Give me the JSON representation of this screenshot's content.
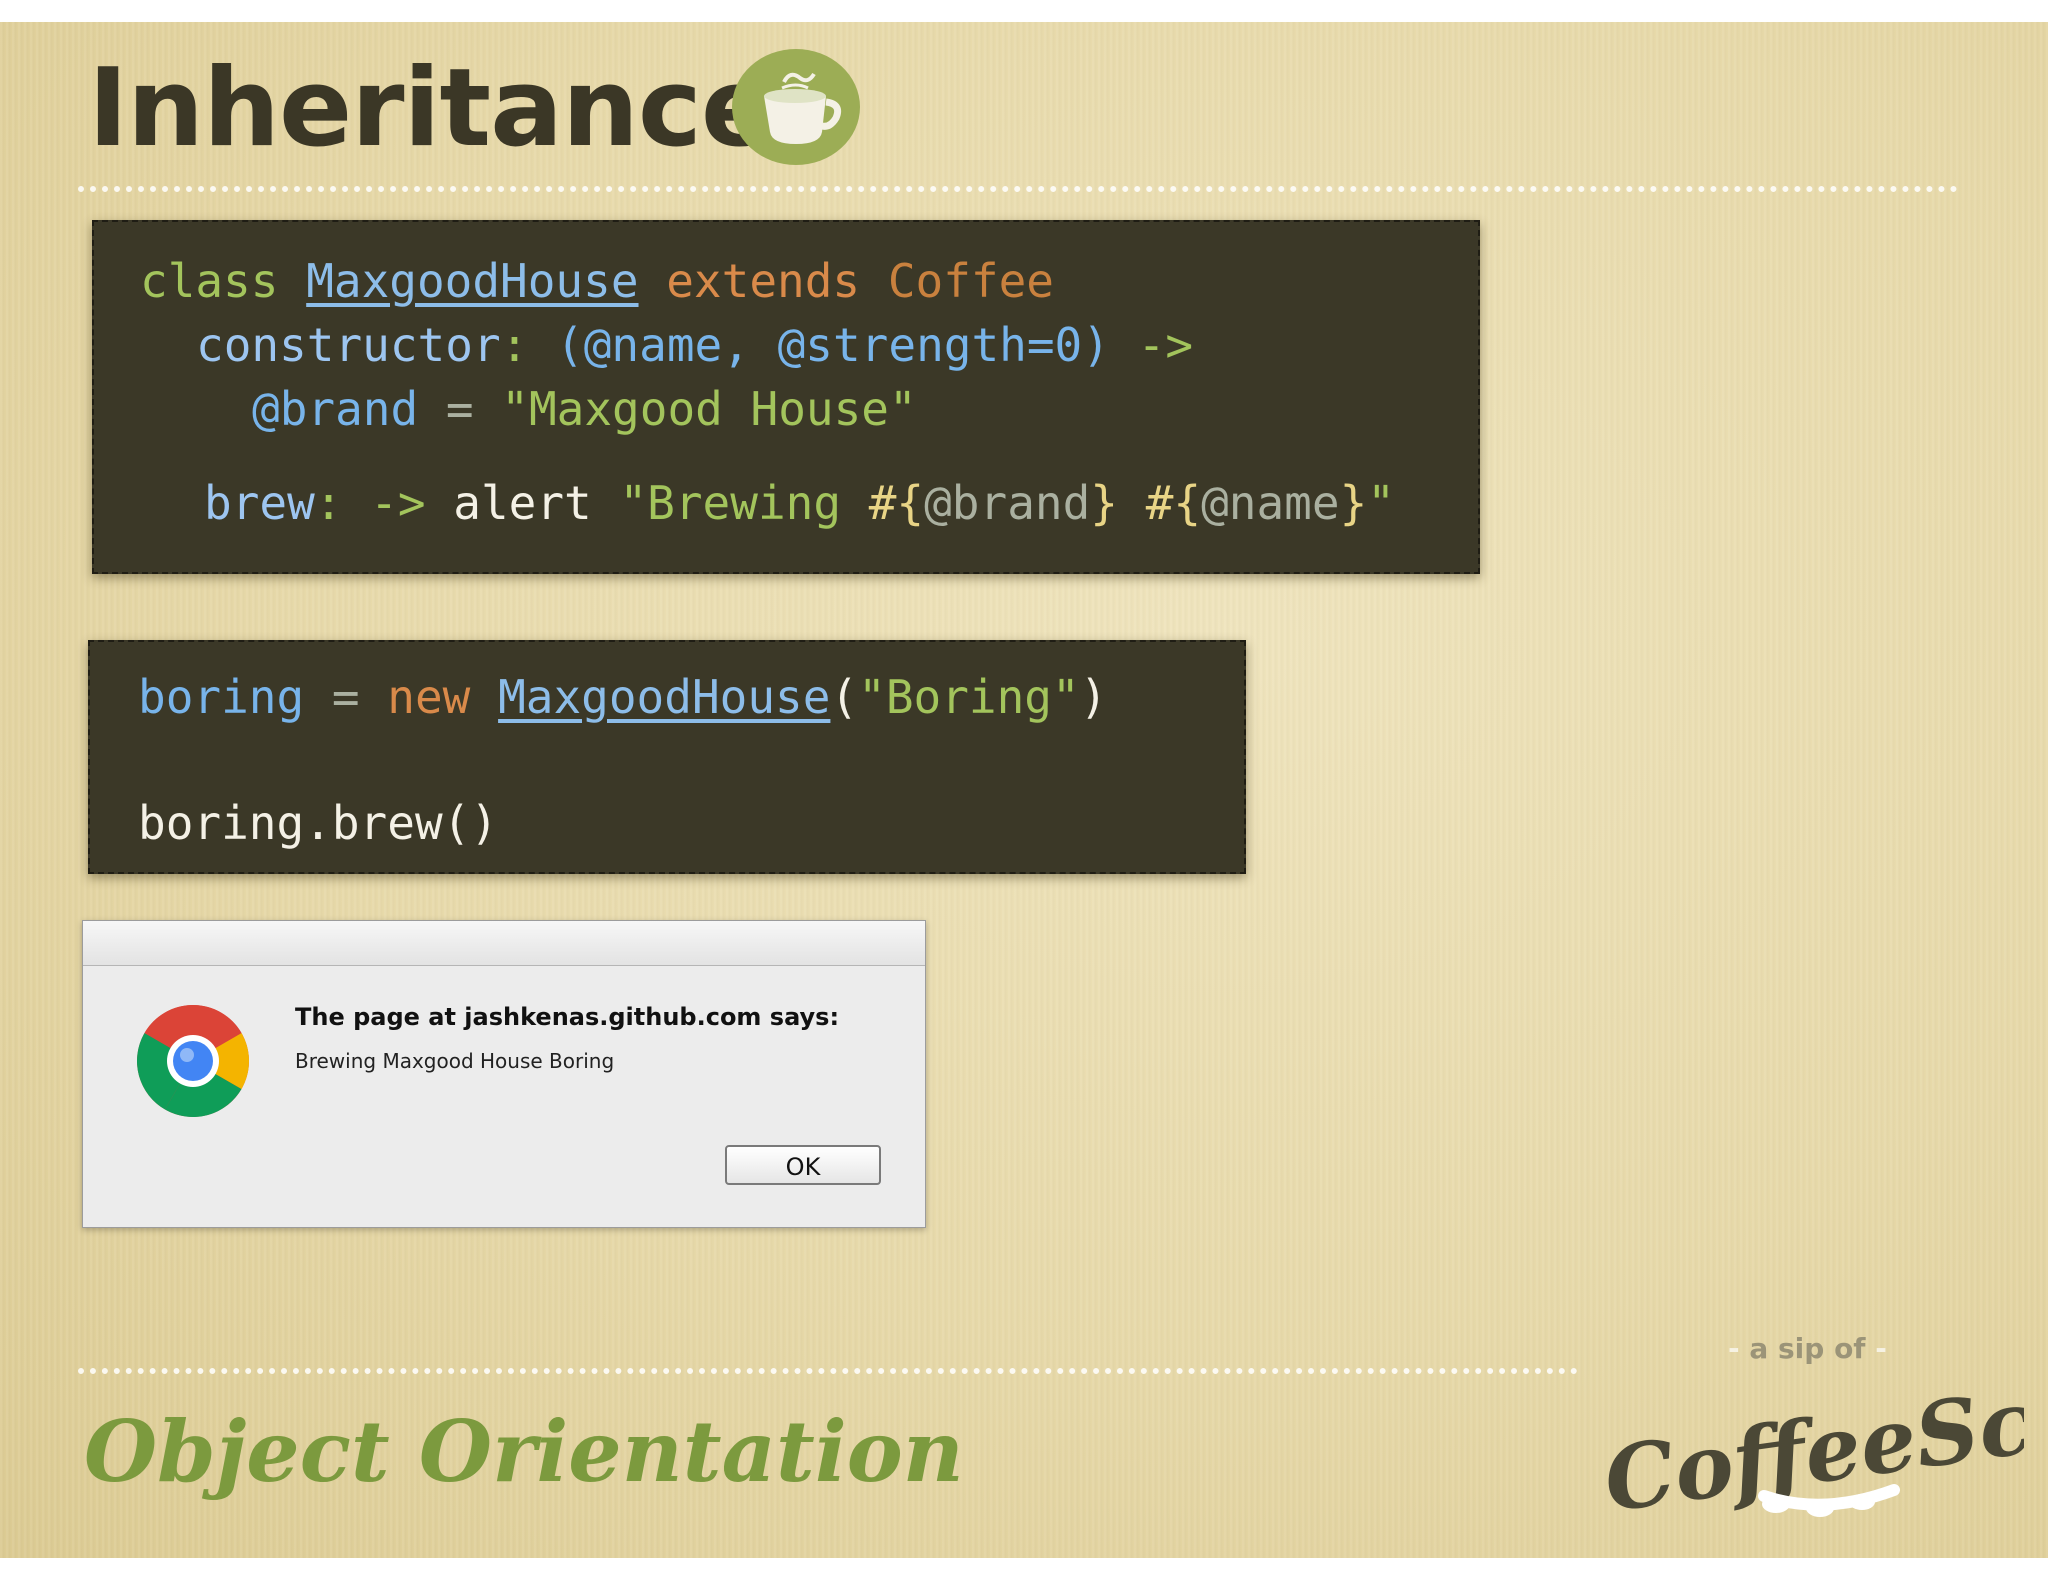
{
  "slide": {
    "title": "Inheritance",
    "subtitle": "Object Orientation"
  },
  "code_block_1": {
    "line1": {
      "kw": "class",
      "cls": "MaxgoodHouse",
      "extends": "extends",
      "parent": "Coffee"
    },
    "line2": {
      "prop": "constructor",
      "colon": ":",
      "params": "(@name, @strength=0)",
      "arrow": "->"
    },
    "line3": {
      "var": "@brand",
      "eq": "=",
      "str": "\"Maxgood House\""
    },
    "line4": {
      "prop": "brew",
      "colon": ":",
      "arrow": "->",
      "fn": "alert",
      "str_open": "\"Brewing ",
      "interp1_open": "#{",
      "interp1_var": "@brand",
      "interp1_close": "}",
      "space": " ",
      "interp2_open": "#{",
      "interp2_var": "@name",
      "interp2_close": "}",
      "str_close": "\""
    }
  },
  "code_block_2": {
    "line1": {
      "var": "boring",
      "eq": "=",
      "kw": "new",
      "cls": "MaxgoodHouse",
      "paren_open": "(",
      "str": "\"Boring\"",
      "paren_close": ")"
    },
    "line2": {
      "text": "boring.brew()"
    }
  },
  "alert_dialog": {
    "heading": "The page at jashkenas.github.com says:",
    "message": "Brewing Maxgood House Boring",
    "ok_label": "OK",
    "icon": "chrome-icon"
  },
  "logo": {
    "tagline_dash_left": "-",
    "tagline": "a sip of",
    "tagline_dash_right": "-",
    "wordmark": "CoffeeScript"
  },
  "colors": {
    "background": "#e7d9a9",
    "code_bg": "#3b3827",
    "keyword": "#a3c45c",
    "class_name": "#8dbde9",
    "parent_class": "#c9813e",
    "subtitle": "#7c9a3e"
  }
}
